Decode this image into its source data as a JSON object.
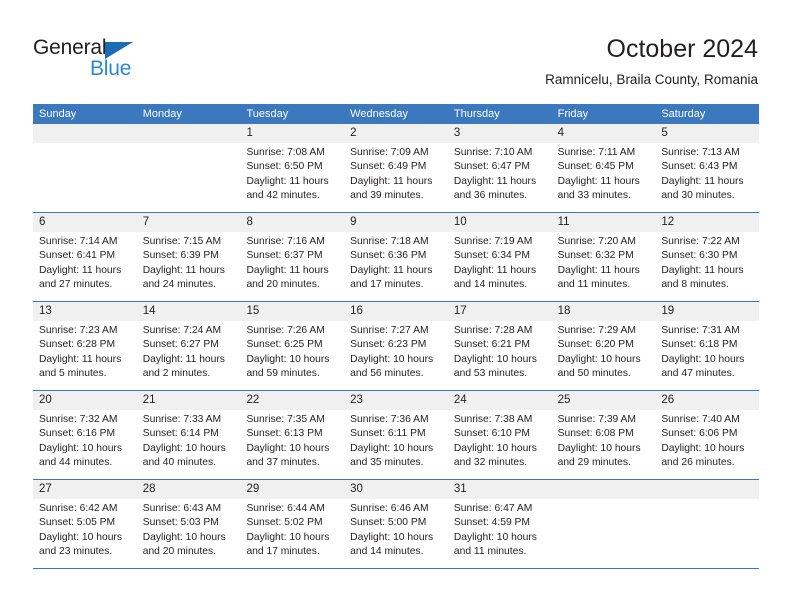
{
  "brand": {
    "name_top": "General",
    "name_bottom": "Blue",
    "accent_color": "#2b8ad6",
    "triangle_color": "#1b6cb5"
  },
  "header": {
    "month_title": "October 2024",
    "location": "Ramnicelu, Braila County, Romania"
  },
  "theme": {
    "header_blue": "#3b78bd",
    "daynum_band": "#f0f0f0",
    "text": "#231f20"
  },
  "calendar": {
    "weekday_headers": [
      "Sunday",
      "Monday",
      "Tuesday",
      "Wednesday",
      "Thursday",
      "Friday",
      "Saturday"
    ],
    "weeks": [
      [
        {
          "day": "",
          "lines": []
        },
        {
          "day": "",
          "lines": []
        },
        {
          "day": "1",
          "lines": [
            "Sunrise: 7:08 AM",
            "Sunset: 6:50 PM",
            "Daylight: 11 hours",
            "and 42 minutes."
          ]
        },
        {
          "day": "2",
          "lines": [
            "Sunrise: 7:09 AM",
            "Sunset: 6:49 PM",
            "Daylight: 11 hours",
            "and 39 minutes."
          ]
        },
        {
          "day": "3",
          "lines": [
            "Sunrise: 7:10 AM",
            "Sunset: 6:47 PM",
            "Daylight: 11 hours",
            "and 36 minutes."
          ]
        },
        {
          "day": "4",
          "lines": [
            "Sunrise: 7:11 AM",
            "Sunset: 6:45 PM",
            "Daylight: 11 hours",
            "and 33 minutes."
          ]
        },
        {
          "day": "5",
          "lines": [
            "Sunrise: 7:13 AM",
            "Sunset: 6:43 PM",
            "Daylight: 11 hours",
            "and 30 minutes."
          ]
        }
      ],
      [
        {
          "day": "6",
          "lines": [
            "Sunrise: 7:14 AM",
            "Sunset: 6:41 PM",
            "Daylight: 11 hours",
            "and 27 minutes."
          ]
        },
        {
          "day": "7",
          "lines": [
            "Sunrise: 7:15 AM",
            "Sunset: 6:39 PM",
            "Daylight: 11 hours",
            "and 24 minutes."
          ]
        },
        {
          "day": "8",
          "lines": [
            "Sunrise: 7:16 AM",
            "Sunset: 6:37 PM",
            "Daylight: 11 hours",
            "and 20 minutes."
          ]
        },
        {
          "day": "9",
          "lines": [
            "Sunrise: 7:18 AM",
            "Sunset: 6:36 PM",
            "Daylight: 11 hours",
            "and 17 minutes."
          ]
        },
        {
          "day": "10",
          "lines": [
            "Sunrise: 7:19 AM",
            "Sunset: 6:34 PM",
            "Daylight: 11 hours",
            "and 14 minutes."
          ]
        },
        {
          "day": "11",
          "lines": [
            "Sunrise: 7:20 AM",
            "Sunset: 6:32 PM",
            "Daylight: 11 hours",
            "and 11 minutes."
          ]
        },
        {
          "day": "12",
          "lines": [
            "Sunrise: 7:22 AM",
            "Sunset: 6:30 PM",
            "Daylight: 11 hours",
            "and 8 minutes."
          ]
        }
      ],
      [
        {
          "day": "13",
          "lines": [
            "Sunrise: 7:23 AM",
            "Sunset: 6:28 PM",
            "Daylight: 11 hours",
            "and 5 minutes."
          ]
        },
        {
          "day": "14",
          "lines": [
            "Sunrise: 7:24 AM",
            "Sunset: 6:27 PM",
            "Daylight: 11 hours",
            "and 2 minutes."
          ]
        },
        {
          "day": "15",
          "lines": [
            "Sunrise: 7:26 AM",
            "Sunset: 6:25 PM",
            "Daylight: 10 hours",
            "and 59 minutes."
          ]
        },
        {
          "day": "16",
          "lines": [
            "Sunrise: 7:27 AM",
            "Sunset: 6:23 PM",
            "Daylight: 10 hours",
            "and 56 minutes."
          ]
        },
        {
          "day": "17",
          "lines": [
            "Sunrise: 7:28 AM",
            "Sunset: 6:21 PM",
            "Daylight: 10 hours",
            "and 53 minutes."
          ]
        },
        {
          "day": "18",
          "lines": [
            "Sunrise: 7:29 AM",
            "Sunset: 6:20 PM",
            "Daylight: 10 hours",
            "and 50 minutes."
          ]
        },
        {
          "day": "19",
          "lines": [
            "Sunrise: 7:31 AM",
            "Sunset: 6:18 PM",
            "Daylight: 10 hours",
            "and 47 minutes."
          ]
        }
      ],
      [
        {
          "day": "20",
          "lines": [
            "Sunrise: 7:32 AM",
            "Sunset: 6:16 PM",
            "Daylight: 10 hours",
            "and 44 minutes."
          ]
        },
        {
          "day": "21",
          "lines": [
            "Sunrise: 7:33 AM",
            "Sunset: 6:14 PM",
            "Daylight: 10 hours",
            "and 40 minutes."
          ]
        },
        {
          "day": "22",
          "lines": [
            "Sunrise: 7:35 AM",
            "Sunset: 6:13 PM",
            "Daylight: 10 hours",
            "and 37 minutes."
          ]
        },
        {
          "day": "23",
          "lines": [
            "Sunrise: 7:36 AM",
            "Sunset: 6:11 PM",
            "Daylight: 10 hours",
            "and 35 minutes."
          ]
        },
        {
          "day": "24",
          "lines": [
            "Sunrise: 7:38 AM",
            "Sunset: 6:10 PM",
            "Daylight: 10 hours",
            "and 32 minutes."
          ]
        },
        {
          "day": "25",
          "lines": [
            "Sunrise: 7:39 AM",
            "Sunset: 6:08 PM",
            "Daylight: 10 hours",
            "and 29 minutes."
          ]
        },
        {
          "day": "26",
          "lines": [
            "Sunrise: 7:40 AM",
            "Sunset: 6:06 PM",
            "Daylight: 10 hours",
            "and 26 minutes."
          ]
        }
      ],
      [
        {
          "day": "27",
          "lines": [
            "Sunrise: 6:42 AM",
            "Sunset: 5:05 PM",
            "Daylight: 10 hours",
            "and 23 minutes."
          ]
        },
        {
          "day": "28",
          "lines": [
            "Sunrise: 6:43 AM",
            "Sunset: 5:03 PM",
            "Daylight: 10 hours",
            "and 20 minutes."
          ]
        },
        {
          "day": "29",
          "lines": [
            "Sunrise: 6:44 AM",
            "Sunset: 5:02 PM",
            "Daylight: 10 hours",
            "and 17 minutes."
          ]
        },
        {
          "day": "30",
          "lines": [
            "Sunrise: 6:46 AM",
            "Sunset: 5:00 PM",
            "Daylight: 10 hours",
            "and 14 minutes."
          ]
        },
        {
          "day": "31",
          "lines": [
            "Sunrise: 6:47 AM",
            "Sunset: 4:59 PM",
            "Daylight: 10 hours",
            "and 11 minutes."
          ]
        },
        {
          "day": "",
          "lines": []
        },
        {
          "day": "",
          "lines": []
        }
      ]
    ]
  }
}
